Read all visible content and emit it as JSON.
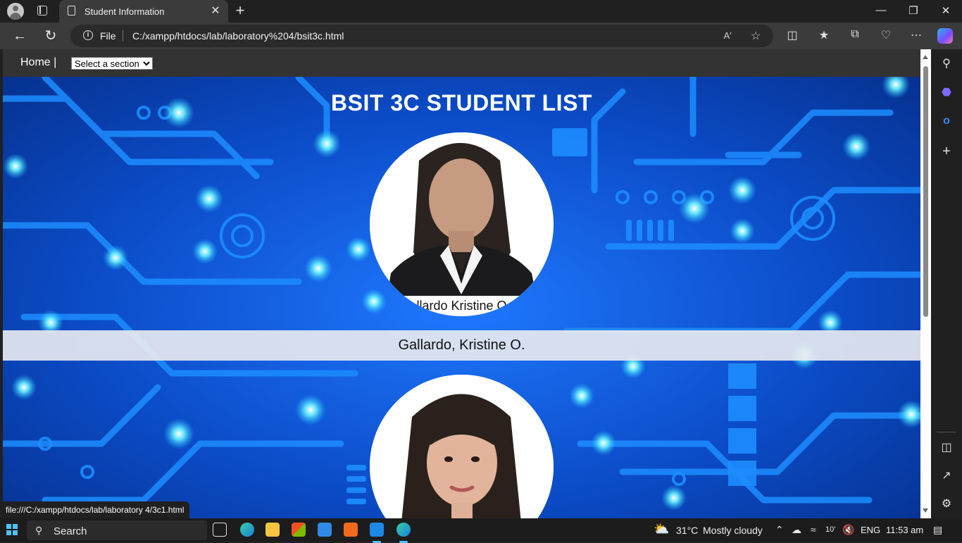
{
  "browser": {
    "tab_title": "Student Information",
    "tab_close": "✕",
    "new_tab": "+",
    "address_scheme": "File",
    "address_url": "C:/xampp/htdocs/lab/laboratory%204/bsit3c.html",
    "status_link": "file:///C:/xampp/htdocs/lab/laboratory 4/3c1.html"
  },
  "page": {
    "nav": {
      "home_label": "Home |",
      "section_select": {
        "selected": "Select a section",
        "options": [
          "Select a section"
        ]
      }
    },
    "title": "BSIT 3C STUDENT LIST",
    "students": [
      {
        "photo_caption": "llardo Kristine O",
        "name": "Gallardo, Kristine O."
      },
      {
        "photo_caption": "",
        "name": ""
      }
    ]
  },
  "taskbar": {
    "search_label": "Search",
    "weather_temp": "31°C",
    "weather_text": "Mostly cloudy",
    "language": "ENG",
    "time": "11:53 am"
  },
  "colors": {
    "accent": "#4cc2ff",
    "page_bg": "#0a3fa8",
    "navbar_bg": "#333333",
    "name_band": "#e6e9f0"
  }
}
